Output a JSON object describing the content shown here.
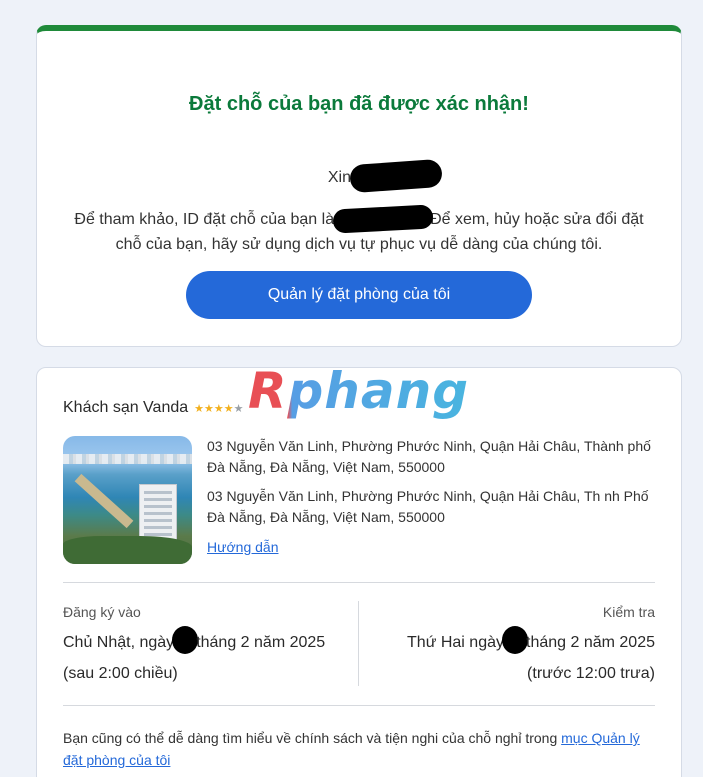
{
  "confirm": {
    "title": "Đặt chỗ của bạn đã được xác nhận!",
    "greeting": "Xin chào",
    "reference_prefix": "Để tham khảo, ID đặt chỗ của bạn là",
    "reference_suffix": "Để xem, hủy hoặc sửa đổi đặt chỗ của bạn, hãy sử dụng dịch vụ tự phục vụ dễ dàng của chúng tôi.",
    "manage_button": "Quản lý đặt phòng của tôi"
  },
  "watermark": {
    "text": "Rphang"
  },
  "hotel": {
    "name": "Khách sạn Vanda",
    "stars_filled": "★★★★",
    "stars_empty": "★",
    "rating": 4,
    "address_1": "03 Nguyễn Văn Linh, Phường Phước Ninh, Quận Hải Châu, Thành phố Đà Nẵng, Đà Nẵng, Việt Nam, 550000",
    "address_2": "03 Nguyễn Văn Linh, Phường Phước Ninh, Quận Hải Châu, Th nh Phố Đà Nẵng, Đà Nẵng, Việt Nam, 550000",
    "directions": "Hướng dẫn"
  },
  "checkin": {
    "label": "Đăng ký vào",
    "date_prefix": "Chủ Nhật, ngày",
    "date_suffix": "tháng 2 năm 2025",
    "time": "(sau 2:00 chiều)"
  },
  "checkout": {
    "label": "Kiểm tra",
    "date_prefix": "Thứ Hai ngày",
    "date_suffix": "tháng 2 năm 2025",
    "time": "(trước 12:00 trưa)"
  },
  "policy": {
    "text": "Bạn cũng có thể dễ dàng tìm hiểu về chính sách và tiện nghi của chỗ nghỉ trong ",
    "link": "mục Quản lý đặt phòng của tôi"
  },
  "colors": {
    "accent_green": "#0b7a3b",
    "button_blue": "#2469d9",
    "star_gold": "#f2b01e"
  }
}
